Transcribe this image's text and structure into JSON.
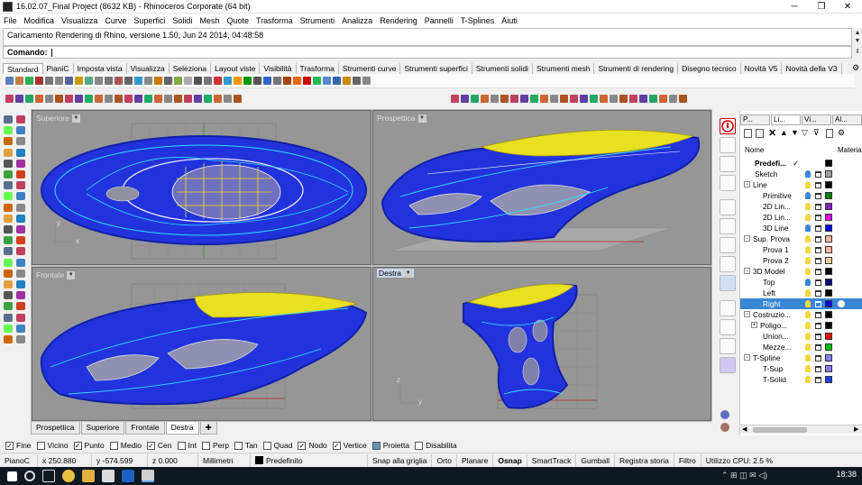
{
  "window": {
    "title": "16.02.07_Final Project (8632 KB) - Rhinoceros Corporate (64 bit)",
    "minimize": "─",
    "maximize": "❐",
    "close": "✕"
  },
  "menu": [
    "File",
    "Modifica",
    "Visualizza",
    "Curve",
    "Superfici",
    "Solidi",
    "Mesh",
    "Quote",
    "Trasforma",
    "Strumenti",
    "Analizza",
    "Rendering",
    "Pannelli",
    "T-Splines",
    "Aiuti"
  ],
  "history": {
    "text": "Caricamento Rendering di Rhino, versione 1.50, Jun 24 2014, 04:48:58"
  },
  "command": {
    "label": "Comando:"
  },
  "toolbar_tabs": [
    "Standard",
    "PianiC",
    "Imposta vista",
    "Visualizza",
    "Seleziona",
    "Layout viste",
    "Visibilità",
    "Trasforma",
    "Strumenti curve",
    "Strumenti superfici",
    "Strumenti solidi",
    "Strumenti mesh",
    "Strumenti di rendering",
    "Disegno tecnico",
    "Novità V5",
    "Novità della V3"
  ],
  "viewports": {
    "top": {
      "label": "Superiore",
      "x_axis": "x",
      "y_axis": "y"
    },
    "perspective": {
      "label": "Prospettica"
    },
    "front": {
      "label": "Frontale",
      "x_axis": "x",
      "z_axis": "z"
    },
    "right": {
      "label": "Destra",
      "y_axis": "y",
      "z_axis": "z"
    }
  },
  "viewport_tabs": [
    "Prospettica",
    "Superiore",
    "Frontale",
    "Destra"
  ],
  "viewport_tab_add": "✚",
  "layer_panel": {
    "tabs": [
      "P...",
      "Li...",
      "Vi...",
      "Al..."
    ],
    "col_name": "Nome",
    "col_material": "Material",
    "layers": [
      {
        "name": "Predefi...",
        "indent": 0,
        "expander": "",
        "color": "#000000",
        "bold": true,
        "current": "✓",
        "selected": false
      },
      {
        "name": "Sketch",
        "indent": 0,
        "expander": "",
        "color": "#a0a0a0",
        "bold": false,
        "current": "",
        "selected": false
      },
      {
        "name": "Line",
        "indent": 0,
        "expander": "−",
        "color": "#000000",
        "bold": false,
        "current": "",
        "selected": false
      },
      {
        "name": "Primitive",
        "indent": 2,
        "expander": "",
        "color": "#008000",
        "bold": false,
        "current": "",
        "selected": false
      },
      {
        "name": "2D Lin...",
        "indent": 2,
        "expander": "",
        "color": "#8020c0",
        "bold": false,
        "current": "",
        "selected": false
      },
      {
        "name": "2D Lin...",
        "indent": 2,
        "expander": "",
        "color": "#ff00ff",
        "bold": false,
        "current": "",
        "selected": false
      },
      {
        "name": "3D Line",
        "indent": 2,
        "expander": "",
        "color": "#0000ff",
        "bold": false,
        "current": "",
        "selected": false
      },
      {
        "name": "Sup. Prova",
        "indent": 0,
        "expander": "−",
        "color": "#f4b6a0",
        "bold": false,
        "current": "",
        "selected": false
      },
      {
        "name": "Prova 1",
        "indent": 2,
        "expander": "",
        "color": "#f4b6a0",
        "bold": false,
        "current": "",
        "selected": false
      },
      {
        "name": "Prova 2",
        "indent": 2,
        "expander": "",
        "color": "#f0d090",
        "bold": false,
        "current": "",
        "selected": false
      },
      {
        "name": "3D Model",
        "indent": 0,
        "expander": "−",
        "color": "#000000",
        "bold": false,
        "current": "",
        "selected": false
      },
      {
        "name": "Top",
        "indent": 2,
        "expander": "",
        "color": "#000080",
        "bold": false,
        "current": "",
        "selected": false
      },
      {
        "name": "Left",
        "indent": 2,
        "expander": "",
        "color": "#000000",
        "bold": false,
        "current": "",
        "selected": false
      },
      {
        "name": "Right",
        "indent": 2,
        "expander": "",
        "color": "#0000ff",
        "bold": false,
        "current": "",
        "selected": true
      },
      {
        "name": "Costruzio...",
        "indent": 0,
        "expander": "−",
        "color": "#000000",
        "bold": false,
        "current": "",
        "selected": false
      },
      {
        "name": "Poligo...",
        "indent": 1,
        "expander": "+",
        "color": "#000000",
        "bold": false,
        "current": "",
        "selected": false
      },
      {
        "name": "Union...",
        "indent": 2,
        "expander": "",
        "color": "#ff0000",
        "bold": false,
        "current": "",
        "selected": false
      },
      {
        "name": "Mezze...",
        "indent": 2,
        "expander": "",
        "color": "#00c000",
        "bold": false,
        "current": "",
        "selected": false
      },
      {
        "name": "T-Spline",
        "indent": 0,
        "expander": "−",
        "color": "#8080ff",
        "bold": false,
        "current": "",
        "selected": false
      },
      {
        "name": "T-Sup",
        "indent": 2,
        "expander": "",
        "color": "#8080ff",
        "bold": false,
        "current": "",
        "selected": false
      },
      {
        "name": "T-Solid",
        "indent": 2,
        "expander": "",
        "color": "#2040ff",
        "bold": false,
        "current": "",
        "selected": false
      }
    ]
  },
  "osnap": [
    {
      "label": "Fine",
      "checked": true
    },
    {
      "label": "Vicino",
      "checked": false
    },
    {
      "label": "Punto",
      "checked": true
    },
    {
      "label": "Medio",
      "checked": false
    },
    {
      "label": "Cen",
      "checked": true
    },
    {
      "label": "Int",
      "checked": false
    },
    {
      "label": "Perp",
      "checked": false
    },
    {
      "label": "Tan",
      "checked": false
    },
    {
      "label": "Quad",
      "checked": false
    },
    {
      "label": "Nodo",
      "checked": true
    },
    {
      "label": "Vertice",
      "checked": true
    },
    {
      "label": "Proietta",
      "checked": false
    },
    {
      "label": "Disabilita",
      "checked": false
    }
  ],
  "status": {
    "cplane": "PianoC",
    "x": "x 250.880",
    "y": "y -574.599",
    "z": "z 0.000",
    "units": "Millimetri",
    "layer": "Predefinito",
    "items": [
      "Snap alla griglia",
      "Orto",
      "Planare",
      "Osnap",
      "SmartTrack",
      "Gumball",
      "Registra storia",
      "Filtro",
      "Utilizzo CPU: 2.5 %"
    ]
  },
  "taskbar": {
    "time": "18:38"
  },
  "colors": {
    "model_blue": "#2233dd",
    "highlight_yellow": "#e8e020",
    "edge_cyan": "#30e0ff",
    "viewport_bg": "#969696"
  }
}
